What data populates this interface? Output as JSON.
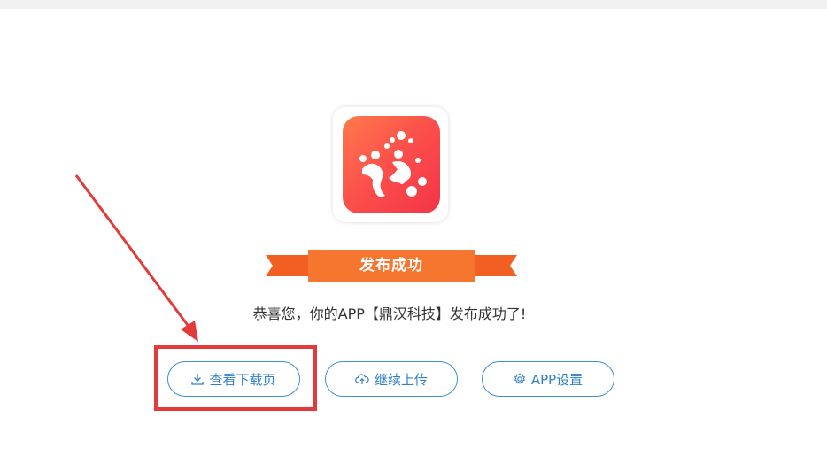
{
  "banner": {
    "title": "发布成功"
  },
  "message": {
    "text": "恭喜您，你的APP【鼎汉科技】发布成功了!"
  },
  "buttons": {
    "download": {
      "label": "查看下载页",
      "icon": "download-icon"
    },
    "continue": {
      "label": "继续上传",
      "icon": "cloud-upload-icon"
    },
    "settings": {
      "label": "APP设置",
      "icon": "gear-icon"
    }
  },
  "colors": {
    "banner_orange": "#f26b2a",
    "button_blue": "#3d8fd6",
    "highlight_red": "#e33a3a",
    "icon_gradient_start": "#ff7a4c",
    "icon_gradient_end": "#f23547"
  }
}
